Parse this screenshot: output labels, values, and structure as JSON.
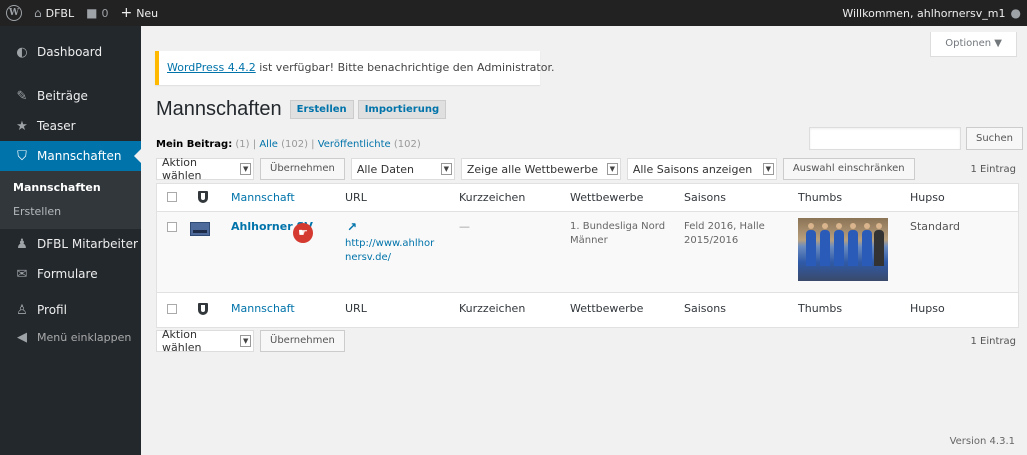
{
  "adminbar": {
    "site_name": "DFBL",
    "comments_count": "0",
    "new_label": "Neu",
    "welcome": "Willkommen, ahlhornersv_m1"
  },
  "sidebar": {
    "items": [
      {
        "label": "Dashboard",
        "icon": "dashboard-icon"
      },
      {
        "label": "Beiträge",
        "icon": "pin-icon"
      },
      {
        "label": "Teaser",
        "icon": "star-icon"
      },
      {
        "label": "Mannschaften",
        "icon": "shield-icon"
      },
      {
        "label": "DFBL Mitarbeiter",
        "icon": "people-icon"
      },
      {
        "label": "Formulare",
        "icon": "mail-icon"
      },
      {
        "label": "Profil",
        "icon": "user-icon"
      },
      {
        "label": "Menü einklappen",
        "icon": "collapse-icon"
      }
    ],
    "submenu": [
      "Mannschaften",
      "Erstellen"
    ]
  },
  "options_label": "Optionen ▼",
  "notice": {
    "link": "WordPress 4.4.2",
    "text": " ist verfügbar! Bitte benachrichtige den Administrator."
  },
  "page": {
    "title": "Mannschaften",
    "buttons": [
      "Erstellen",
      "Importierung"
    ]
  },
  "views": {
    "mine_label": "Mein Beitrag:",
    "mine_count": "(1)",
    "all_label": "Alle",
    "all_count": "(102)",
    "published_label": "Veröffentlichte",
    "published_count": "(102)"
  },
  "search_button": "Suchen",
  "filters": {
    "bulk_action": "Aktion wählen",
    "apply": "Übernehmen",
    "dates": "Alle Daten",
    "competitions": "Zeige alle Wettbewerbe",
    "seasons": "Alle Saisons anzeigen",
    "filter_button": "Auswahl einschränken",
    "count": "1 Eintrag"
  },
  "table": {
    "columns": [
      "Mannschaft",
      "URL",
      "Kurzzeichen",
      "Wettbewerbe",
      "Saisons",
      "Thumbs",
      "Hupso"
    ],
    "row": {
      "name": "Ahlhorner SV",
      "url": "http://www.ahlhornersv.de/",
      "short": "—",
      "competition": "1. Bundesliga Nord Männer",
      "seasons": "Feld 2016, Halle 2015/2016",
      "hupso": "Standard"
    }
  },
  "version": "Version 4.3.1"
}
